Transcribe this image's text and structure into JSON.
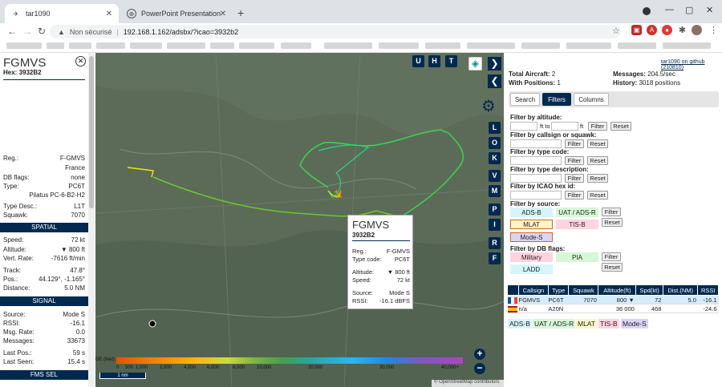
{
  "browser": {
    "tabs": [
      {
        "title": "tar1090",
        "close": "✕",
        "active": true
      },
      {
        "title": "PowerPoint Presentation",
        "close": "✕",
        "active": false
      }
    ],
    "new_tab": "+",
    "window_controls": [
      "—",
      "▢",
      "✕"
    ],
    "address": {
      "warning": "Non sécurisé",
      "url": "192.168.1.162/adsbx/?icao=3932b2"
    }
  },
  "left_panel": {
    "callsign": "FGMVS",
    "hex_label": "Hex:",
    "hex": "3932B2",
    "close": "✕",
    "rows_top": [
      {
        "k": "Reg.:",
        "v": "F-GMVS"
      },
      {
        "k": "",
        "v": "France"
      },
      {
        "k": "DB flags:",
        "v": "none"
      },
      {
        "k": "Type:",
        "v": "PC6T"
      },
      {
        "k": "",
        "v": "Pilatus PC-6-B2-H2"
      },
      {
        "k": "Type Desc.:",
        "v": "L1T"
      },
      {
        "k": "Squawk:",
        "v": "7070"
      }
    ],
    "spatial_header": "SPATIAL",
    "rows_spatial": [
      {
        "k": "Speed:",
        "v": "72 kt"
      },
      {
        "k": "Altitude:",
        "v": "▼ 800 ft"
      },
      {
        "k": "Vert. Rate:",
        "v": "-7616 ft/min"
      },
      {
        "k": "Track:",
        "v": "47.8°"
      },
      {
        "k": "Pos.:",
        "v": "44.129°, -1.165°"
      },
      {
        "k": "Distance:",
        "v": "5.0 NM"
      }
    ],
    "signal_header": "SIGNAL",
    "rows_signal": [
      {
        "k": "Source:",
        "v": "Mode S"
      },
      {
        "k": "RSSI:",
        "v": "-16.1"
      },
      {
        "k": "Msg. Rate:",
        "v": "0.0"
      },
      {
        "k": "Messages:",
        "v": "33673"
      },
      {
        "k": "Last Pos.:",
        "v": "59 s"
      },
      {
        "k": "Last Seen:",
        "v": "15.4 s"
      }
    ],
    "fms_header": "FMS SEL"
  },
  "map": {
    "top_buttons": [
      "U",
      "H",
      "T"
    ],
    "side_buttons": [
      "L",
      "O",
      "K",
      "V",
      "M",
      "P",
      "I",
      "R",
      "F"
    ],
    "popup": {
      "callsign": "FGMVS",
      "hex": "3932B2",
      "rows": [
        {
          "k": "Reg.:",
          "v": "F-GMVS"
        },
        {
          "k": "Type code:",
          "v": "PC6T"
        },
        {
          "k": "Altitude:",
          "v": "▼ 800 ft"
        },
        {
          "k": "Speed:",
          "v": "72 kt"
        },
        {
          "k": "Source:",
          "v": "Mode S"
        },
        {
          "k": "RSSI:",
          "v": "-16.1 dBFS"
        }
      ]
    },
    "legend_label": "DE (feet)",
    "legend_ticks": [
      "0",
      "500",
      "1,000",
      "2,000",
      "4,000",
      "6,000",
      "8,000",
      "10,000",
      "20,000",
      "30,000",
      "40,000+"
    ],
    "scale": "1 nm",
    "zoom_in": "+",
    "zoom_out": "−",
    "attribution": "© OpenStreetMap contributors"
  },
  "right_panel": {
    "github": "tar1090 on github (210810)",
    "total_aircraft_label": "Total Aircraft:",
    "total_aircraft": "2",
    "with_positions_label": "With Positions:",
    "with_positions": "1",
    "messages_label": "Messages:",
    "messages": "204.5/sec",
    "history_label": "History:",
    "history": "3018 positions",
    "tabs": [
      "Search",
      "Filters",
      "Columns"
    ],
    "filters": {
      "altitude": "Filter by altitude:",
      "ft_to": "ft to",
      "ft": "ft",
      "callsign": "Filter by callsign or squawk:",
      "type_code": "Filter by type code:",
      "type_desc": "Filter by type description:",
      "icao": "Filter by ICAO hex id:",
      "source": "Filter by source:",
      "dbflags": "Filter by DB flags:",
      "filter_btn": "Filter",
      "reset_btn": "Reset",
      "sources": [
        "ADS-B",
        "UAT / ADS-R",
        "MLAT",
        "TIS-B",
        "Mode-S"
      ],
      "db": [
        "Military",
        "PIA",
        "LADD"
      ]
    },
    "table": {
      "headers": [
        "Callsign",
        "Type",
        "Squawk",
        "Altitude(ft)",
        "Spd(kt)",
        "Dist.(NM)",
        "RSSI"
      ],
      "rows": [
        {
          "callsign": "FGMVS",
          "type": "PC6T",
          "squawk": "7070",
          "altitude": "800 ▼",
          "speed": "72",
          "dist": "5.0",
          "rssi": "-16.1"
        },
        {
          "callsign": "n/a",
          "type": "A20N",
          "squawk": "",
          "altitude": "36 000",
          "speed": "468",
          "dist": "",
          "rssi": "-24.6"
        }
      ]
    },
    "legend": [
      "ADS-B",
      "UAT / ADS-R",
      "MLAT",
      "TIS-B",
      "Mode-S"
    ]
  }
}
